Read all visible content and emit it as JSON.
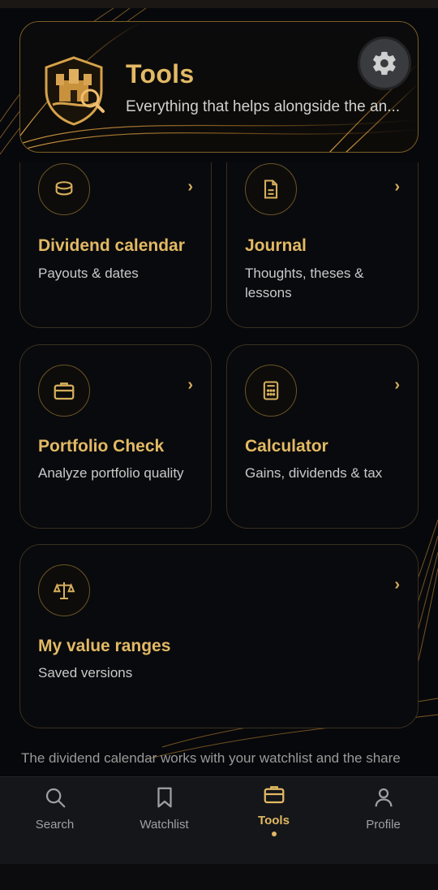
{
  "header": {
    "title": "Tools",
    "subtitle": "Everything that helps alongside the an..."
  },
  "tiles": [
    {
      "title": "Dividend calendar",
      "subtitle": "Payouts & dates",
      "icon": "coins-icon"
    },
    {
      "title": "Journal",
      "subtitle": "Thoughts, theses & lessons",
      "icon": "document-icon"
    },
    {
      "title": "Portfolio Check",
      "subtitle": "Analyze portfolio quality",
      "icon": "briefcase-icon"
    },
    {
      "title": "Calculator",
      "subtitle": "Gains, dividends & tax",
      "icon": "calculator-icon"
    },
    {
      "title": "My value ranges",
      "subtitle": "Saved versions",
      "icon": "scale-icon"
    }
  ],
  "chevron": "›",
  "footnote": "The dividend calendar works with your watchlist and the share",
  "nav": {
    "items": [
      {
        "label": "Search",
        "icon": "search-icon"
      },
      {
        "label": "Watchlist",
        "icon": "bookmark-icon"
      },
      {
        "label": "Tools",
        "icon": "toolbox-icon",
        "active": true
      },
      {
        "label": "Profile",
        "icon": "person-icon"
      }
    ]
  },
  "colors": {
    "accent": "#e2b964",
    "background": "#07080b",
    "nav_background": "#151619"
  }
}
